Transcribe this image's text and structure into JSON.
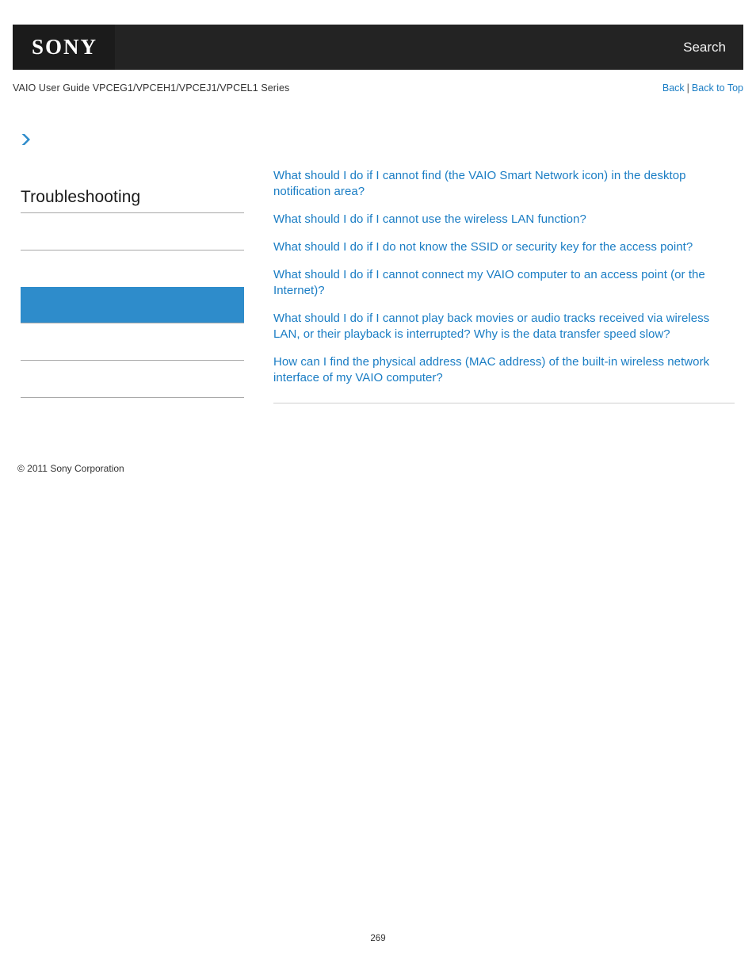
{
  "header": {
    "logo_text": "SONY",
    "search_label": "Search",
    "guide_title": "VAIO User Guide VPCEG1/VPCEH1/VPCEJ1/VPCEL1 Series",
    "back_label": "Back",
    "separator": "|",
    "back_to_top_label": "Back to Top"
  },
  "sidebar": {
    "breadcrumb_icon": "chevron-right-icon",
    "section_title": "Troubleshooting",
    "slots": [
      {
        "label": "",
        "active": false
      },
      {
        "label": "",
        "active": false
      },
      {
        "label": "",
        "active": true
      },
      {
        "label": "",
        "active": false
      },
      {
        "label": "",
        "active": false
      }
    ]
  },
  "main": {
    "links": [
      "What should I do if I cannot find (the VAIO Smart Network icon) in the desktop notification area?",
      "What should I do if I cannot use the wireless LAN function?",
      "What should I do if I do not know the SSID or security key for the access point?",
      "What should I do if I cannot connect my VAIO computer to an access point (or the Internet)?",
      "What should I do if I cannot play back movies or audio tracks received via wireless LAN, or their playback is interrupted? Why is the data transfer speed slow?",
      "How can I find the physical address (MAC address) of the built-in wireless network interface of my VAIO computer?"
    ]
  },
  "footer": {
    "copyright": "© 2011 Sony Corporation",
    "page_number": "269"
  },
  "colors": {
    "header_bg": "#232323",
    "logo_bg": "#1b1b1b",
    "link_blue": "#1a7dc4",
    "highlight_blue": "#2e8ccb",
    "rule_gray": "#a8a8a8",
    "content_rule_gray": "#cfcfcf"
  }
}
